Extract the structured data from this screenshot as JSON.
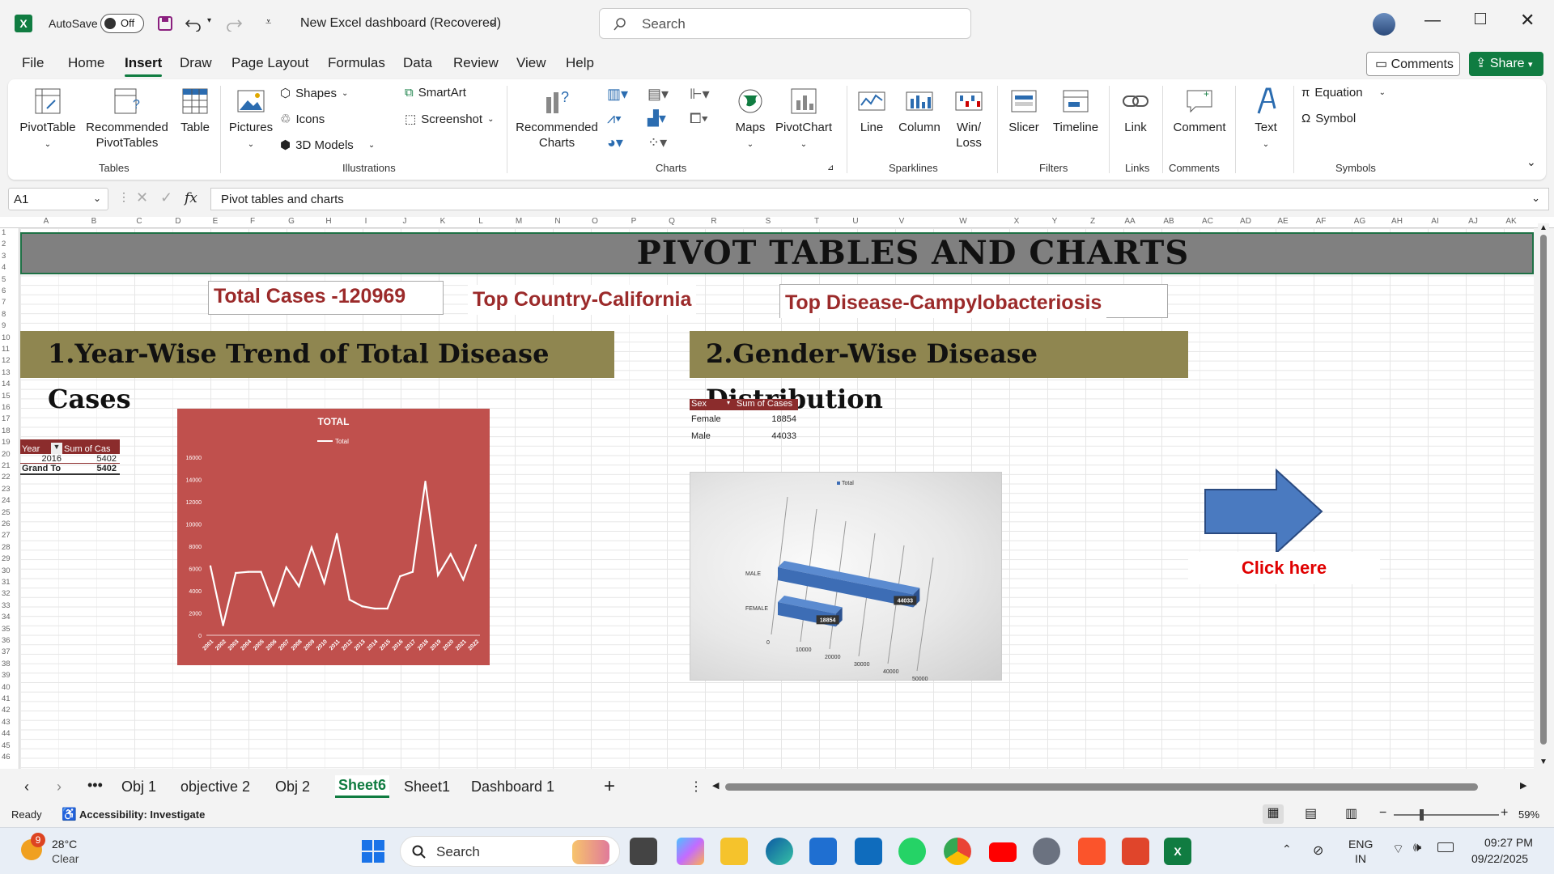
{
  "titlebar": {
    "autosave_label": "AutoSave",
    "autosave_state": "Off",
    "document_title": "New Excel dashboard (Recovered)",
    "search_placeholder": "Search"
  },
  "menu": [
    "File",
    "Home",
    "Insert",
    "Draw",
    "Page Layout",
    "Formulas",
    "Data",
    "Review",
    "View",
    "Help"
  ],
  "menu_active": "Insert",
  "menu_right": {
    "comments": "Comments",
    "share": "Share"
  },
  "ribbon": {
    "tables": {
      "label": "Tables",
      "pivottable": "PivotTable",
      "recommended_pivot_1": "Recommended",
      "recommended_pivot_2": "PivotTables",
      "table": "Table"
    },
    "illustrations": {
      "label": "Illustrations",
      "pictures": "Pictures",
      "shapes": "Shapes",
      "icons": "Icons",
      "models": "3D Models",
      "smartart": "SmartArt",
      "screenshot": "Screenshot"
    },
    "charts": {
      "label": "Charts",
      "recommended_1": "Recommended",
      "recommended_2": "Charts",
      "maps": "Maps",
      "pivotchart": "PivotChart"
    },
    "sparklines": {
      "label": "Sparklines",
      "line": "Line",
      "column": "Column",
      "winloss_1": "Win/",
      "winloss_2": "Loss"
    },
    "filters": {
      "label": "Filters",
      "slicer": "Slicer",
      "timeline": "Timeline"
    },
    "links": {
      "label": "Links",
      "link": "Link"
    },
    "comments": {
      "label": "Comments",
      "comment": "Comment"
    },
    "text": {
      "label": "Text"
    },
    "symbols": {
      "label": "Symbols",
      "equation": "Equation",
      "symbol": "Symbol"
    }
  },
  "formula": {
    "cell_ref": "A1",
    "fx": "fx",
    "content": "Pivot tables and charts"
  },
  "columns": [
    "A",
    "B",
    "C",
    "D",
    "E",
    "F",
    "G",
    "H",
    "I",
    "J",
    "K",
    "L",
    "M",
    "N",
    "O",
    "P",
    "Q",
    "R",
    "S",
    "T",
    "U",
    "V",
    "W",
    "X",
    "Y",
    "Z",
    "AA",
    "AB",
    "AC",
    "AD",
    "AE",
    "AF",
    "AG",
    "AH",
    "AI",
    "AJ",
    "AK"
  ],
  "rows_visible": 46,
  "dashboard": {
    "title": "PIVOT TABLES AND CHARTS",
    "kpi_total": "Total Cases -120969",
    "kpi_country": "Top Country-California",
    "kpi_disease": "Top Disease-Campylobacteriosis",
    "section1": "1.Year-Wise Trend of Total Disease Cases",
    "section2": "2.Gender-Wise Disease Distribution",
    "click_here": "Click here"
  },
  "pivot_year": {
    "headers": [
      "Year",
      "Sum of Cas"
    ],
    "rows": [
      [
        "2016",
        "5402"
      ]
    ],
    "total": [
      "Grand To",
      "5402"
    ]
  },
  "pivot_gender": {
    "headers": [
      "Sex",
      "Sum of Cases"
    ],
    "rows": [
      [
        "Female",
        "18854"
      ],
      [
        "Male",
        "44033"
      ]
    ]
  },
  "chart_data": [
    {
      "type": "line",
      "title": "TOTAL",
      "legend": "Total",
      "x": [
        "2001",
        "2002",
        "2003",
        "2004",
        "2005",
        "2006",
        "2007",
        "2008",
        "2009",
        "2010",
        "2011",
        "2012",
        "2013",
        "2014",
        "2015",
        "2016",
        "2017",
        "2018",
        "2019",
        "2020",
        "2021",
        "2022"
      ],
      "values": [
        6200,
        900,
        5600,
        5700,
        5700,
        2700,
        6100,
        4400,
        7900,
        4700,
        9100,
        3200,
        2600,
        2400,
        2400,
        5300,
        5700,
        13800,
        5400,
        7300,
        5000,
        8100
      ],
      "ylim": [
        0,
        16000
      ],
      "yticks": [
        0,
        2000,
        4000,
        6000,
        8000,
        10000,
        12000,
        14000,
        16000
      ],
      "background": "#c0504d",
      "line_color": "#ffffff"
    },
    {
      "type": "bar",
      "orientation": "horizontal-3d",
      "legend": "Total",
      "categories": [
        "FEMALE",
        "MALE"
      ],
      "values": [
        18854,
        44033
      ],
      "xticks": [
        0,
        10000,
        20000,
        30000,
        40000,
        50000
      ],
      "bar_color": "#3d6db5"
    }
  ],
  "sheet_tabs": [
    "Obj 1",
    "objective 2",
    "Obj 2",
    "Sheet6",
    "Sheet1",
    "Dashboard 1"
  ],
  "active_tab": "Sheet6",
  "status": {
    "ready": "Ready",
    "accessibility": "Accessibility: Investigate",
    "zoom": "59%"
  },
  "taskbar": {
    "weather_temp": "28°C",
    "weather_desc": "Clear",
    "weather_badge": "9",
    "search": "Search",
    "lang_1": "ENG",
    "lang_2": "IN",
    "time": "09:27 PM",
    "date": "09/22/2025"
  }
}
